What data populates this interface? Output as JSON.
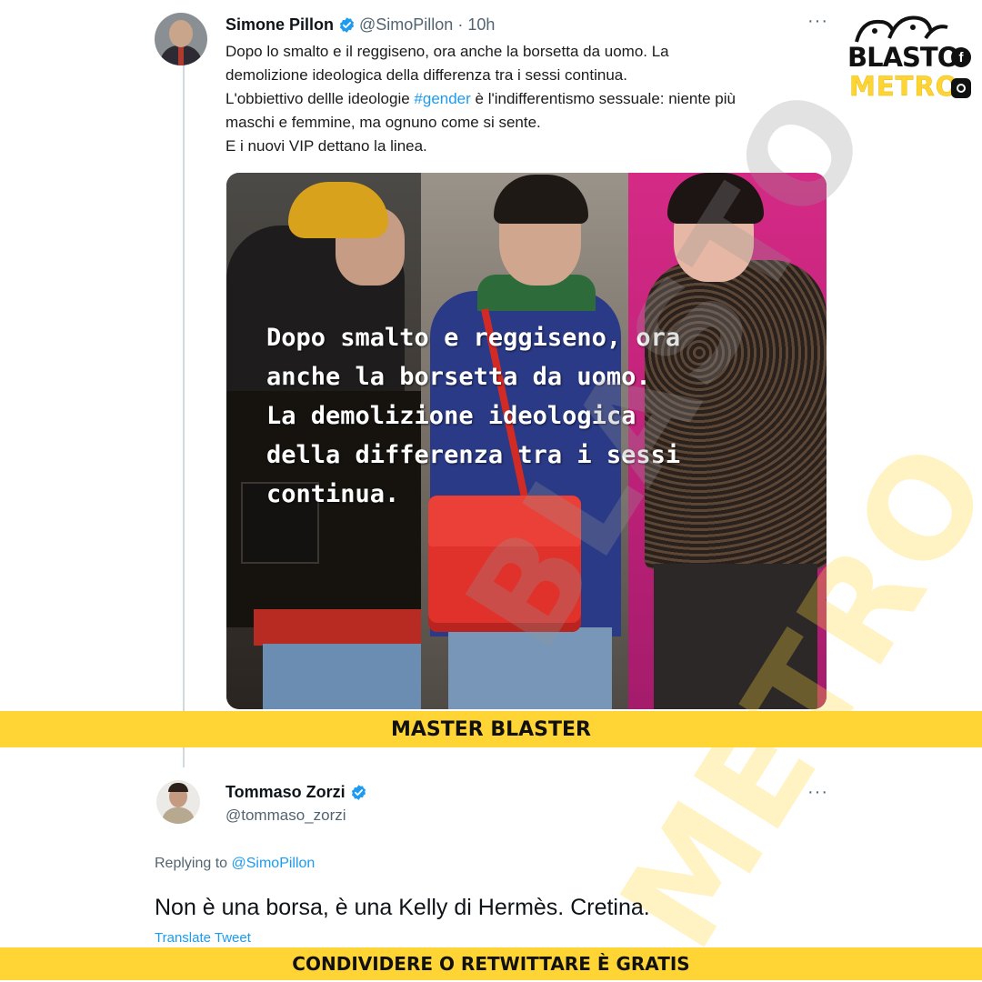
{
  "tweet1": {
    "name": "Simone Pillon",
    "handle": "@SimoPillon",
    "separator": " · ",
    "time": "10h",
    "more": "···",
    "text_line1": "Dopo lo smalto e il reggiseno, ora anche la borsetta da uomo. La",
    "text_line2": "demolizione ideologica della differenza tra i sessi continua.",
    "text_line3_before": "L'obbiettivo dellle ideologie ",
    "hashtag": "#gender",
    "text_line3_after": " è l'indifferentismo sessuale: niente più",
    "text_line4": "maschi e femmine, ma ognuno come si sente.",
    "text_line5": "E i nuovi VIP dettano la linea.",
    "image_overlay": [
      "Dopo smalto e reggiseno, ora",
      "anche la borsetta da uomo.",
      "La demolizione ideologica",
      "della differenza tra i sessi",
      "continua."
    ]
  },
  "banner_top": "MASTER BLASTER",
  "tweet2": {
    "name": "Tommaso Zorzi",
    "handle": "@tommaso_zorzi",
    "more": "···",
    "replying_prefix": "Replying to ",
    "replying_mention": "@SimoPillon",
    "text": "Non è una borsa, è una Kelly di Hermès. Cretina.",
    "translate": "Translate Tweet"
  },
  "banner_bottom": "CONDIVIDERE O RETWITTARE È GRATIS",
  "logo": {
    "word1": "BLASTO",
    "word2": "METRO",
    "facebook_icon": "facebook-icon",
    "instagram_icon": "instagram-icon"
  },
  "watermark": {
    "word1": "BLASTO",
    "word2": "METRO"
  },
  "colors": {
    "banner": "#ffd535",
    "link": "#1d9bf0",
    "verified": "#1d9bf0",
    "secondary_text": "#536471"
  }
}
